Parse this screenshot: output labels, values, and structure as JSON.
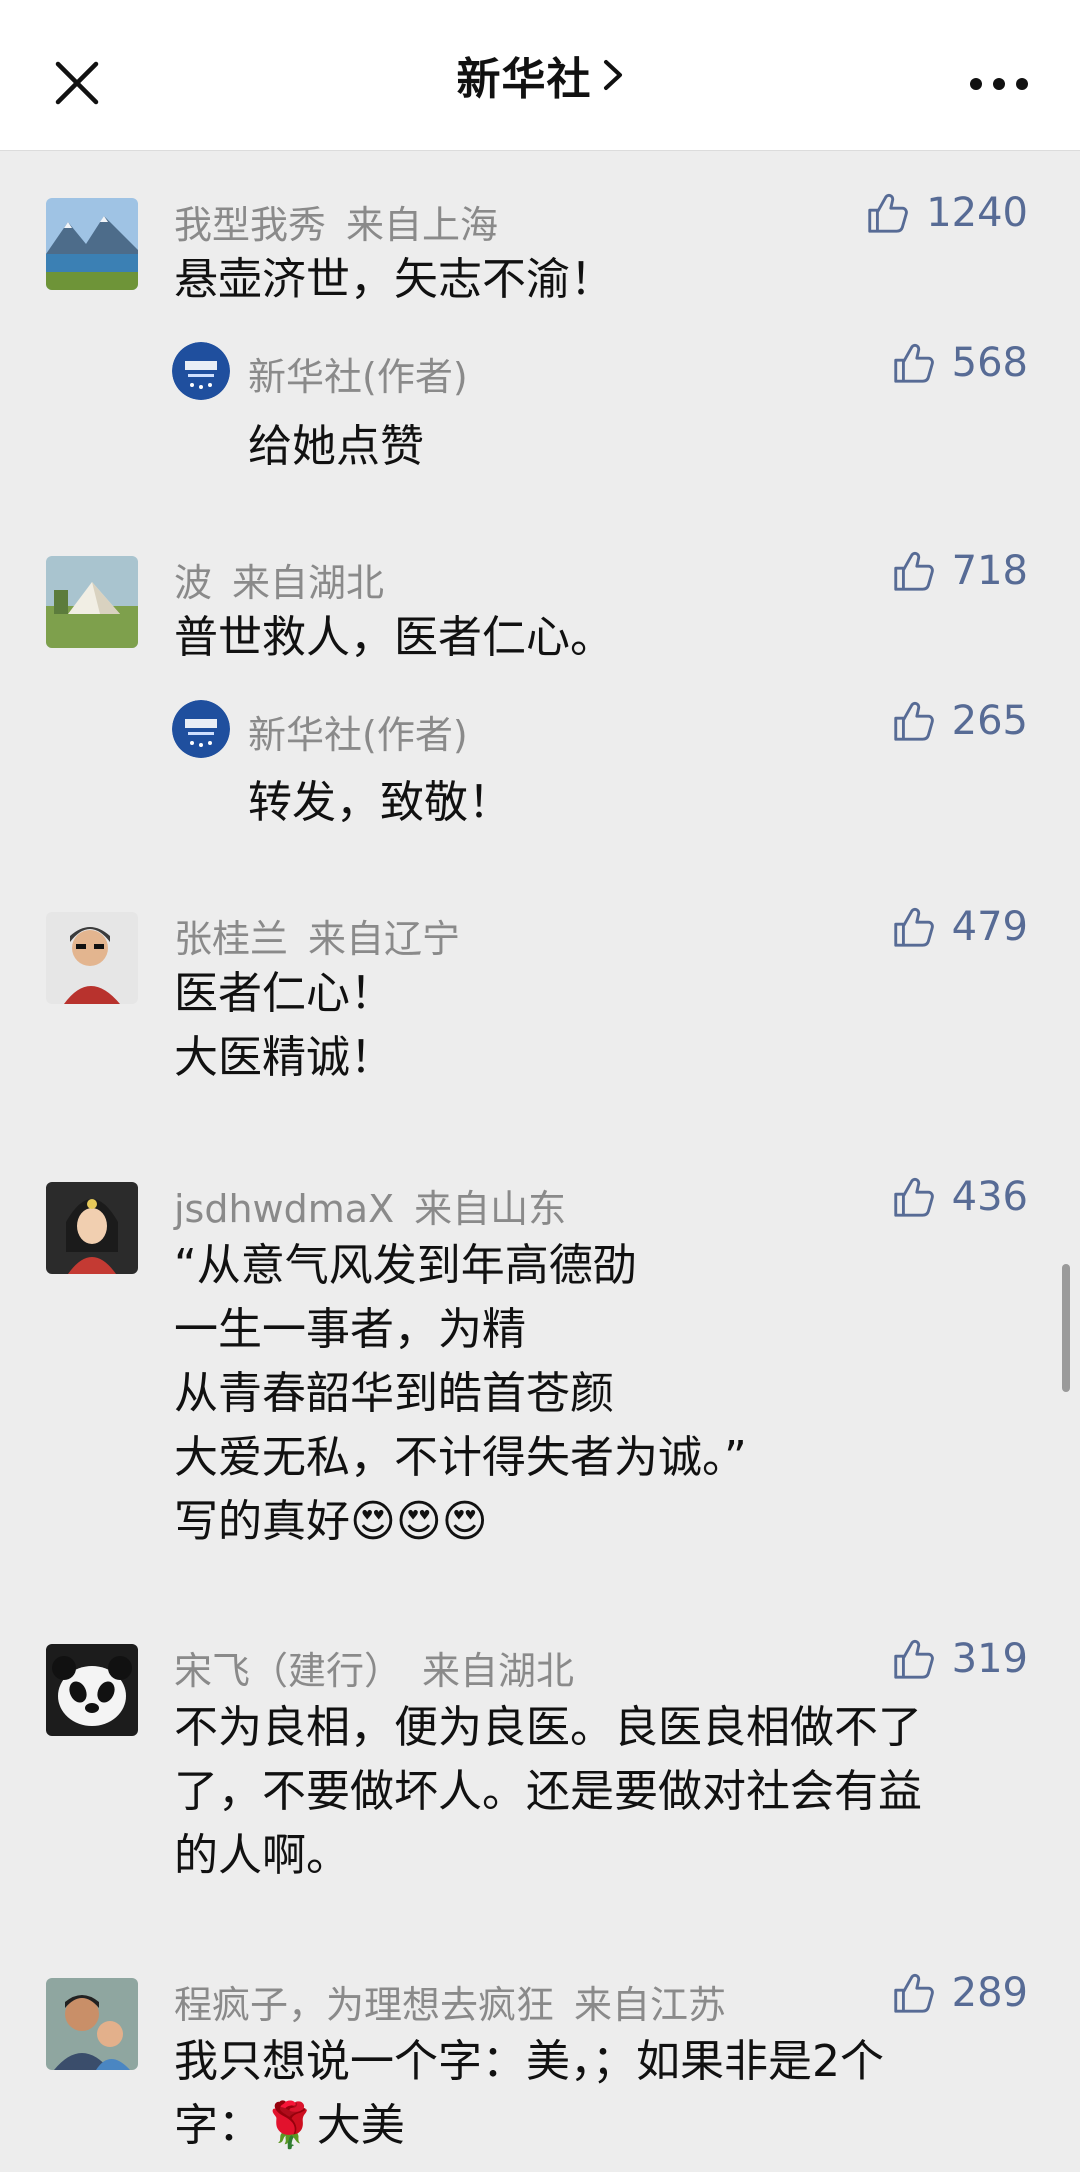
{
  "header": {
    "title": "新华社",
    "close_icon": "close-icon",
    "more_icon": "more-icon",
    "chevron_icon": "chevron-right-icon"
  },
  "comments": [
    {
      "user": "我型我秀",
      "location": "来自上海",
      "likes": "1240",
      "text": "悬壶济世，矢志不渝！",
      "avatar": "mountain-lake-avatar",
      "reply": {
        "user": "新华社(作者)",
        "likes": "568",
        "text": "给她点赞"
      }
    },
    {
      "user": "波",
      "location": "来自湖北",
      "likes": "718",
      "text": "普世救人，医者仁心。",
      "avatar": "camping-tent-avatar",
      "reply": {
        "user": "新华社(作者)",
        "likes": "265",
        "text": "转发，致敬！"
      }
    },
    {
      "user": "张桂兰",
      "location": "来自辽宁",
      "likes": "479",
      "text": [
        "医者仁心！",
        "大医精诚！"
      ],
      "avatar": "woman-snow-avatar"
    },
    {
      "user": "jsdhwdmaX",
      "location": "来自山东",
      "likes": "436",
      "text": [
        "“从意气风发到年高德劭",
        "一生一事者，为精",
        "从青春韶华到皓首苍颜",
        "大爱无私，不计得失者为诚。”",
        "写的真好😍😍😍"
      ],
      "avatar": "illustrated-girl-avatar"
    },
    {
      "user": "宋飞（建行）",
      "location": "来自湖北",
      "likes": "319",
      "text": [
        "不为良相，便为良医。良医良相做不了",
        "了，不要做坏人。还是要做对社会有益",
        "的人啊。"
      ],
      "avatar": "panda-avatar"
    },
    {
      "user": "程疯子，为理想去疯狂",
      "location": "来自江苏",
      "likes": "289",
      "text": [
        "我只想说一个字：美，；如果非是2个",
        "字：🌹大美"
      ],
      "avatar": "father-child-avatar"
    }
  ],
  "colors": {
    "background": "#ededed",
    "header_bg": "#ffffff",
    "like_blue": "#576b95",
    "meta_gray": "#8a8a8a"
  }
}
